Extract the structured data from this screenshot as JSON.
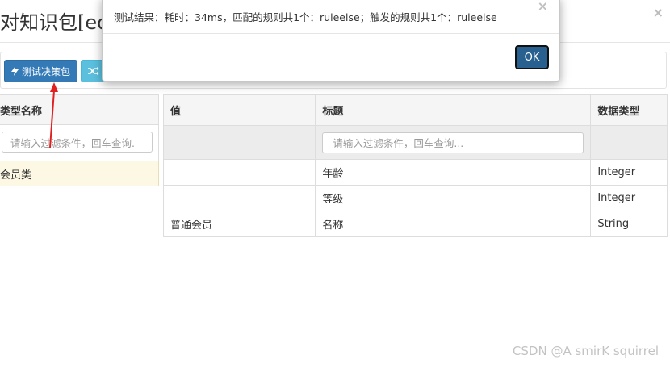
{
  "page": {
    "title": "对知识包[eda"
  },
  "toolbar": {
    "test_button_label": "测试决策包",
    "test_button_icon": "lightning-icon",
    "random_button_icon": "shuffle-icon",
    "primary_color": "#337ab7",
    "info_color": "#5bc0de"
  },
  "left_panel": {
    "header": "类型名称",
    "filter_placeholder": "请输入过滤条件，回车查询.",
    "rows": [
      "会员类"
    ]
  },
  "grid": {
    "columns": [
      "值",
      "标题",
      "数据类型"
    ],
    "filter_placeholder": "请输入过滤条件，回车查询...",
    "rows": [
      {
        "value": "",
        "title": "年龄",
        "type": "Integer"
      },
      {
        "value": "",
        "title": "等级",
        "type": "Integer"
      },
      {
        "value": "普通会员",
        "title": "名称",
        "type": "String"
      }
    ]
  },
  "modal": {
    "message": "测试结果：耗时：34ms，匹配的规则共1个：ruleelse；触发的规则共1个：ruleelse",
    "ok_label": "OK",
    "close_symbol": "×"
  },
  "main_close_symbol": "×",
  "watermark": "CSDN @A smirK squirrel"
}
